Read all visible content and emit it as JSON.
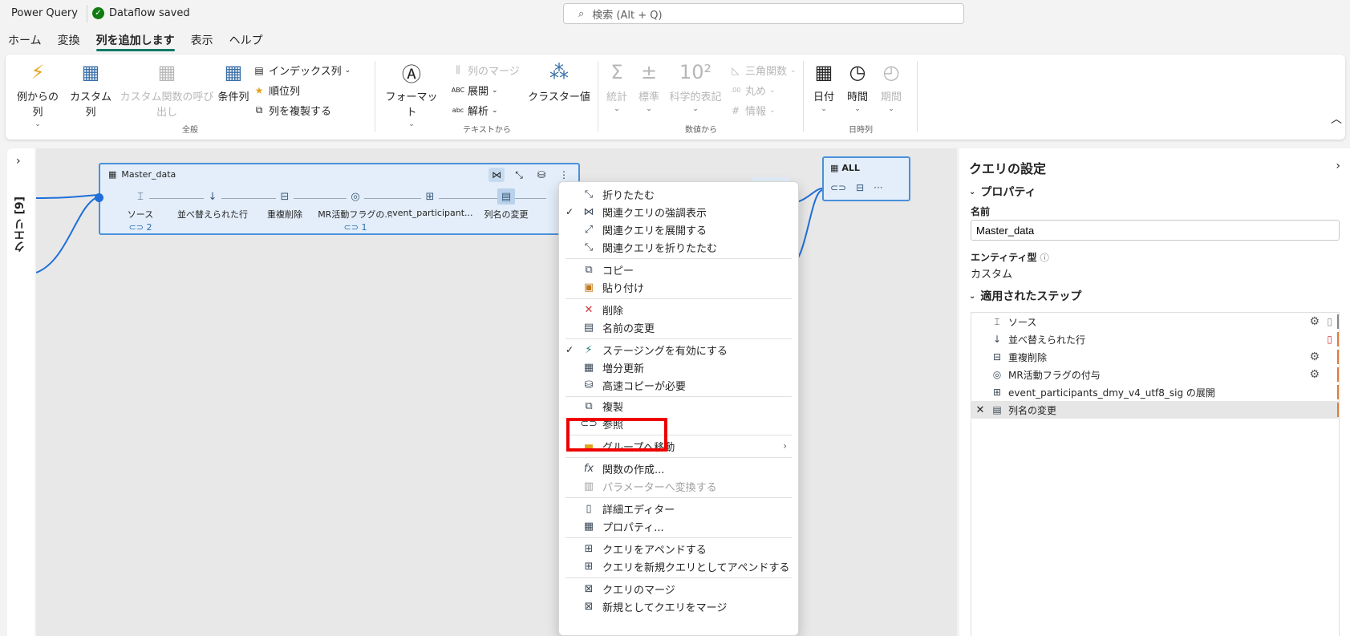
{
  "titlebar": {
    "app_title": "Power Query",
    "saved_status": "Dataflow saved",
    "search_placeholder": "検索 (Alt + Q)"
  },
  "tabs": [
    {
      "label": "ホーム",
      "active": false
    },
    {
      "label": "変換",
      "active": false
    },
    {
      "label": "列を追加します",
      "active": true
    },
    {
      "label": "表示",
      "active": false
    },
    {
      "label": "ヘルプ",
      "active": false
    }
  ],
  "ribbon": {
    "general": {
      "label": "全般",
      "col_from_examples": "例からの列",
      "custom_col": "カスタム列",
      "invoke_custom_function": "カスタム関数の呼び出し",
      "conditional_col": "条件列",
      "index_col": "インデックス列",
      "rank_col": "順位列",
      "duplicate_col": "列を複製する"
    },
    "from_text": {
      "label": "テキストから",
      "format": "フォーマット",
      "merge_cols": "列のマージ",
      "expand": "展開",
      "parse": "解析",
      "cluster_values": "クラスター値"
    },
    "from_number": {
      "label": "数値から",
      "statistics": "統計",
      "standard": "標準",
      "scientific": "科学的表記",
      "trigonometry": "三角関数",
      "rounding": "丸め",
      "information": "情報"
    },
    "datetime": {
      "label": "日時列",
      "date": "日付",
      "time": "時間",
      "duration": "期間"
    }
  },
  "left_panel": {
    "label": "クエリ [9]"
  },
  "query_card": {
    "title": "Master_data",
    "steps": [
      {
        "label": "ソース",
        "count": "2",
        "icon": "source-icon"
      },
      {
        "label": "並べ替えられた行",
        "count": "",
        "icon": "sort-icon"
      },
      {
        "label": "重複削除",
        "count": "",
        "icon": "remove-duplicates-icon"
      },
      {
        "label": "MR活動フラグの...",
        "count": "1",
        "icon": "merge-icon"
      },
      {
        "label": "event_participant...",
        "count": "",
        "icon": "expand-icon"
      },
      {
        "label": "列名の変更",
        "count": "",
        "icon": "rename-column-icon"
      }
    ]
  },
  "all_card": {
    "title": "ALL"
  },
  "context_menu": {
    "items": [
      {
        "label": "折りたたむ",
        "checked": false,
        "icon": "collapse-icon",
        "disabled": false
      },
      {
        "label": "関連クエリの強調表示",
        "checked": true,
        "icon": "related-queries-icon",
        "disabled": false
      },
      {
        "label": "関連クエリを展開する",
        "checked": false,
        "icon": "expand-arrows-icon",
        "disabled": false
      },
      {
        "label": "関連クエリを折りたたむ",
        "checked": false,
        "icon": "collapse-arrows-icon",
        "disabled": false
      },
      {
        "label": "コピー",
        "checked": false,
        "icon": "copy-icon",
        "disabled": false
      },
      {
        "label": "貼り付け",
        "checked": false,
        "icon": "paste-icon",
        "disabled": false
      },
      {
        "label": "削除",
        "checked": false,
        "icon": "delete-icon",
        "disabled": false
      },
      {
        "label": "名前の変更",
        "checked": false,
        "icon": "rename-icon",
        "disabled": false
      },
      {
        "label": "ステージングを有効にする",
        "checked": true,
        "icon": "lightning-icon",
        "disabled": false
      },
      {
        "label": "増分更新",
        "checked": false,
        "icon": "incremental-refresh-icon",
        "disabled": false
      },
      {
        "label": "高速コピーが必要",
        "checked": false,
        "icon": "fast-copy-icon",
        "disabled": false
      },
      {
        "label": "複製",
        "checked": false,
        "icon": "duplicate-icon",
        "disabled": false
      },
      {
        "label": "参照",
        "checked": false,
        "icon": "reference-icon",
        "disabled": false
      },
      {
        "label": "グループへ移動",
        "checked": false,
        "icon": "folder-icon",
        "disabled": false,
        "submenu": true
      },
      {
        "label": "関数の作成...",
        "checked": false,
        "icon": "function-icon",
        "disabled": false
      },
      {
        "label": "パラメーターへ変換する",
        "checked": false,
        "icon": "parameter-icon",
        "disabled": true
      },
      {
        "label": "詳細エディター",
        "checked": false,
        "icon": "advanced-editor-icon",
        "disabled": false
      },
      {
        "label": "プロパティ...",
        "checked": false,
        "icon": "properties-icon",
        "disabled": false
      },
      {
        "label": "クエリをアペンドする",
        "checked": false,
        "icon": "append-icon",
        "disabled": false
      },
      {
        "label": "クエリを新規クエリとしてアペンドする",
        "checked": false,
        "icon": "append-new-icon",
        "disabled": false
      },
      {
        "label": "クエリのマージ",
        "checked": false,
        "icon": "merge-queries-icon",
        "disabled": false
      },
      {
        "label": "新規としてクエリをマージ",
        "checked": false,
        "icon": "merge-new-icon",
        "disabled": false
      }
    ]
  },
  "query_settings": {
    "title": "クエリの設定",
    "properties_header": "プロパティ",
    "name_label": "名前",
    "name_value": "Master_data",
    "entity_type_label": "エンティティ型",
    "entity_type_value": "カスタム",
    "applied_steps_header": "適用されたステップ",
    "applied_steps": [
      {
        "label": "ソース",
        "icon": "source-icon"
      },
      {
        "label": "並べ替えられた行",
        "icon": "sort-icon"
      },
      {
        "label": "重複削除",
        "icon": "remove-duplicates-icon"
      },
      {
        "label": "MR活動フラグの付与",
        "icon": "merge-icon"
      },
      {
        "label": "event_participants_dmy_v4_utf8_sig の展開",
        "icon": "expand-icon"
      },
      {
        "label": "列名の変更",
        "icon": "rename-column-icon",
        "selected": true
      }
    ]
  }
}
